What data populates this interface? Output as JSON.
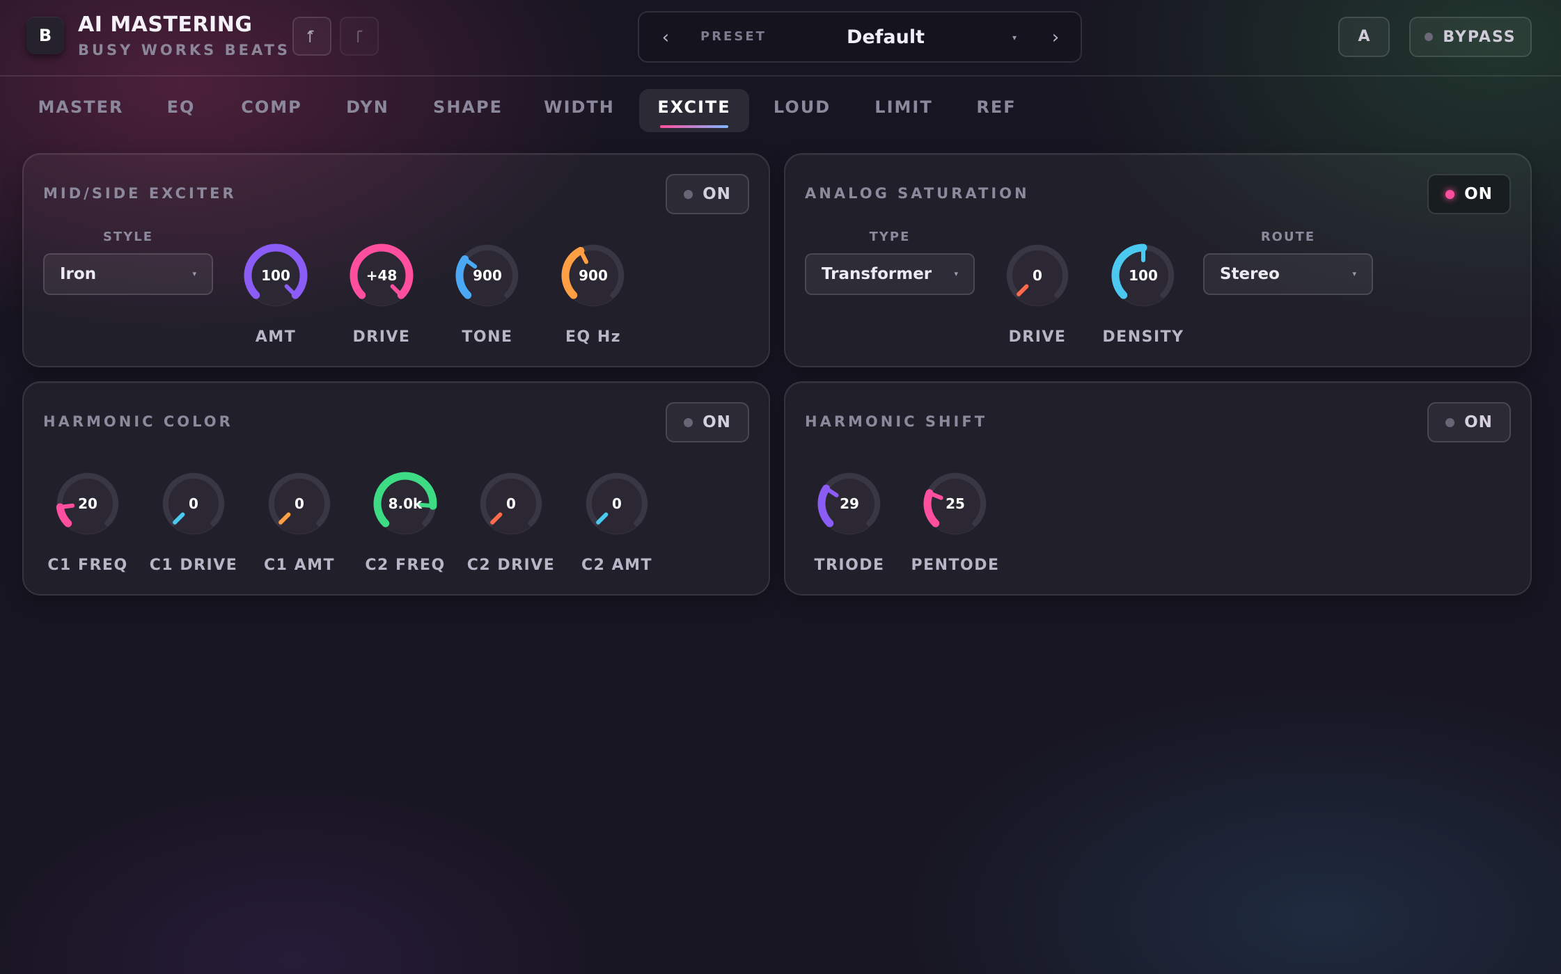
{
  "header": {
    "logo_letter": "B",
    "title": "AI MASTERING",
    "subtitle": "BUSY WORKS BEATS",
    "undo_icon": "undo-icon",
    "redo_icon": "redo-icon",
    "preset_label": "PRESET",
    "preset_name": "Default",
    "preset_prev": "‹",
    "preset_next": "›",
    "preset_caret": "▾",
    "ab_label": "A",
    "bypass_label": "BYPASS"
  },
  "tabs": [
    {
      "label": "MASTER",
      "active": false
    },
    {
      "label": "EQ",
      "active": false
    },
    {
      "label": "COMP",
      "active": false
    },
    {
      "label": "DYN",
      "active": false
    },
    {
      "label": "SHAPE",
      "active": false
    },
    {
      "label": "WIDTH",
      "active": false
    },
    {
      "label": "EXCITE",
      "active": true
    },
    {
      "label": "LOUD",
      "active": false
    },
    {
      "label": "LIMIT",
      "active": false
    },
    {
      "label": "REF",
      "active": false
    }
  ],
  "colors": {
    "purple": "#8b5cf6",
    "pink": "#ff4f9e",
    "blue": "#4aa8f5",
    "orange": "#ff9f43",
    "cyan": "#4cc9f0",
    "green": "#3ddc84",
    "coral": "#ff6b4a",
    "track": "#3a3745"
  },
  "panels": {
    "mid_side_exciter": {
      "title": "MID/SIDE EXCITER",
      "on_label": "ON",
      "on_lit": false,
      "style_label": "STYLE",
      "style_value": "Iron",
      "knobs": [
        {
          "label": "AMT",
          "value": "100",
          "level": 1.0,
          "color": "purple"
        },
        {
          "label": "DRIVE",
          "value": "+48",
          "level": 1.0,
          "color": "pink"
        },
        {
          "label": "TONE",
          "value": "900",
          "level": 0.3,
          "color": "blue"
        },
        {
          "label": "EQ Hz",
          "value": "900",
          "level": 0.4,
          "color": "orange"
        }
      ]
    },
    "analog_saturation": {
      "title": "ANALOG SATURATION",
      "on_label": "ON",
      "on_lit": true,
      "type_label": "TYPE",
      "type_value": "Transformer",
      "route_label": "ROUTE",
      "route_value": "Stereo",
      "knobs": [
        {
          "label": "DRIVE",
          "value": "0",
          "level": 0.0,
          "color": "coral"
        },
        {
          "label": "DENSITY",
          "value": "100",
          "level": 0.5,
          "color": "cyan"
        }
      ]
    },
    "harmonic_color": {
      "title": "HARMONIC COLOR",
      "on_label": "ON",
      "on_lit": false,
      "knobs": [
        {
          "label": "C1 FREQ",
          "value": "20",
          "level": 0.14,
          "color": "pink"
        },
        {
          "label": "C1 DRIVE",
          "value": "0",
          "level": 0.0,
          "color": "cyan"
        },
        {
          "label": "C1 AMT",
          "value": "0",
          "level": 0.0,
          "color": "orange"
        },
        {
          "label": "C2 FREQ",
          "value": "8.0k",
          "level": 0.85,
          "color": "green"
        },
        {
          "label": "C2 DRIVE",
          "value": "0",
          "level": 0.0,
          "color": "coral"
        },
        {
          "label": "C2 AMT",
          "value": "0",
          "level": 0.0,
          "color": "cyan"
        }
      ]
    },
    "harmonic_shift": {
      "title": "HARMONIC SHIFT",
      "on_label": "ON",
      "on_lit": false,
      "knobs": [
        {
          "label": "TRIODE",
          "value": "29",
          "level": 0.29,
          "color": "purple"
        },
        {
          "label": "PENTODE",
          "value": "25",
          "level": 0.25,
          "color": "pink"
        }
      ]
    }
  }
}
